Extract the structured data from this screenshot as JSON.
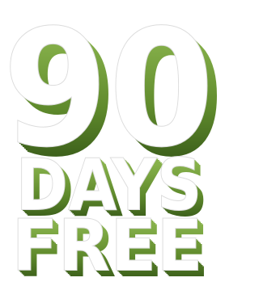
{
  "promo": {
    "number": "90",
    "line1": "DAYS",
    "line2": "FREE"
  },
  "colors": {
    "face": "#ffffff",
    "outline": "#dcdcdc",
    "extrude_light": "#7aa33d",
    "extrude_dark": "#284a14"
  }
}
